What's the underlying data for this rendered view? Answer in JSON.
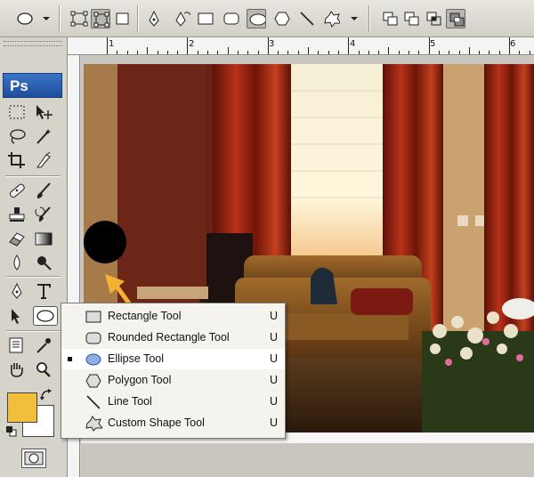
{
  "ruler": {
    "labels": [
      "1",
      "2",
      "3",
      "4",
      "5",
      "6"
    ]
  },
  "toolbox": {
    "logo": "Ps",
    "foreground_color": "#f3bf3a",
    "background_color": "#ffffff"
  },
  "flyout": {
    "items": [
      {
        "label": "Rectangle Tool",
        "shortcut": "U",
        "selected": false,
        "icon": "rectangle-icon"
      },
      {
        "label": "Rounded Rectangle Tool",
        "shortcut": "U",
        "selected": false,
        "icon": "rounded-rectangle-icon"
      },
      {
        "label": "Ellipse Tool",
        "shortcut": "U",
        "selected": true,
        "icon": "ellipse-icon"
      },
      {
        "label": "Polygon Tool",
        "shortcut": "U",
        "selected": false,
        "icon": "polygon-icon"
      },
      {
        "label": "Line Tool",
        "shortcut": "U",
        "selected": false,
        "icon": "line-icon"
      },
      {
        "label": "Custom Shape Tool",
        "shortcut": "U",
        "selected": false,
        "icon": "custom-shape-icon"
      }
    ]
  },
  "colors": {
    "accent": "#f5b133",
    "selection_bg": "#ffffff",
    "ellipse_fill": "#000000"
  }
}
